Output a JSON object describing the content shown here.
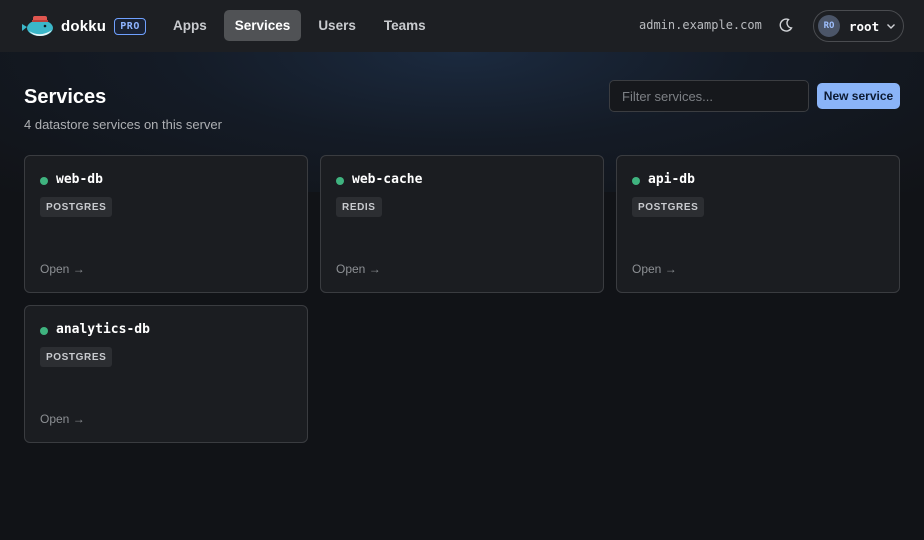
{
  "header": {
    "brand": "dokku",
    "badge": "PRO",
    "nav": [
      "Apps",
      "Services",
      "Users",
      "Teams"
    ],
    "active_nav": "Services",
    "host": "admin.example.com",
    "theme_icon": "moon-icon",
    "user": {
      "initials": "RO",
      "name": "root"
    }
  },
  "page": {
    "title": "Services",
    "subtitle": "4 datastore services on this server",
    "filter_placeholder": "Filter services...",
    "new_button": "New service"
  },
  "services": [
    {
      "name": "web-db",
      "type": "POSTGRES",
      "status_color": "#3fb37f",
      "open_label": "Open →"
    },
    {
      "name": "web-cache",
      "type": "REDIS",
      "status_color": "#3fb37f",
      "open_label": "Open →"
    },
    {
      "name": "api-db",
      "type": "POSTGRES",
      "status_color": "#3fb37f",
      "open_label": "Open →"
    },
    {
      "name": "analytics-db",
      "type": "POSTGRES",
      "status_color": "#3fb37f",
      "open_label": "Open →"
    }
  ],
  "colors": {
    "accent": "#8ab4f8",
    "status_ok": "#3fb37f",
    "background": "#111317"
  }
}
